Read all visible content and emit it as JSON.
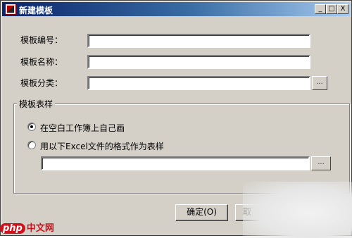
{
  "window": {
    "title": "新建模板",
    "controls": {
      "minimize": "_",
      "maximize": "□",
      "close": "X"
    }
  },
  "form": {
    "template_number_label": "模板编号：",
    "template_number_value": "",
    "template_name_label": "模板名称：",
    "template_name_value": "",
    "template_category_label": "模板分类：",
    "template_category_value": "",
    "browse_label": "..."
  },
  "style_group": {
    "title": "模板表样",
    "options": [
      {
        "label": "在空白工作簿上自己画",
        "selected": true
      },
      {
        "label": "用以下Excel文件的格式作为表样",
        "selected": false
      }
    ],
    "excel_path_value": "",
    "browse_label": "..."
  },
  "buttons": {
    "ok": "确定(O)",
    "cancel": "取"
  },
  "watermark": {
    "logo": "php",
    "text": "中文网"
  }
}
